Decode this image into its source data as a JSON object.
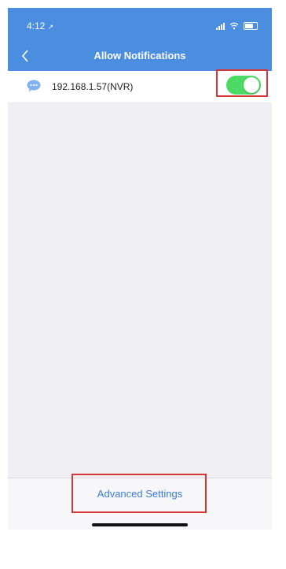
{
  "status_bar": {
    "time": "4:12",
    "icons": [
      "location-arrow-icon",
      "signal-icon",
      "wifi-icon",
      "battery-icon"
    ]
  },
  "nav": {
    "title": "Allow Notifications",
    "back_icon": "chevron-left-icon"
  },
  "list": {
    "items": [
      {
        "label": "192.168.1.57(NVR)",
        "icon": "chat-bubble-icon",
        "toggle_on": true
      }
    ]
  },
  "footer": {
    "advanced_label": "Advanced Settings"
  },
  "colors": {
    "header": "#4b8ee0",
    "toggle_on": "#4cd964",
    "link": "#3b7bd1",
    "highlight_frame": "#d53737",
    "background": "#efeff4"
  }
}
